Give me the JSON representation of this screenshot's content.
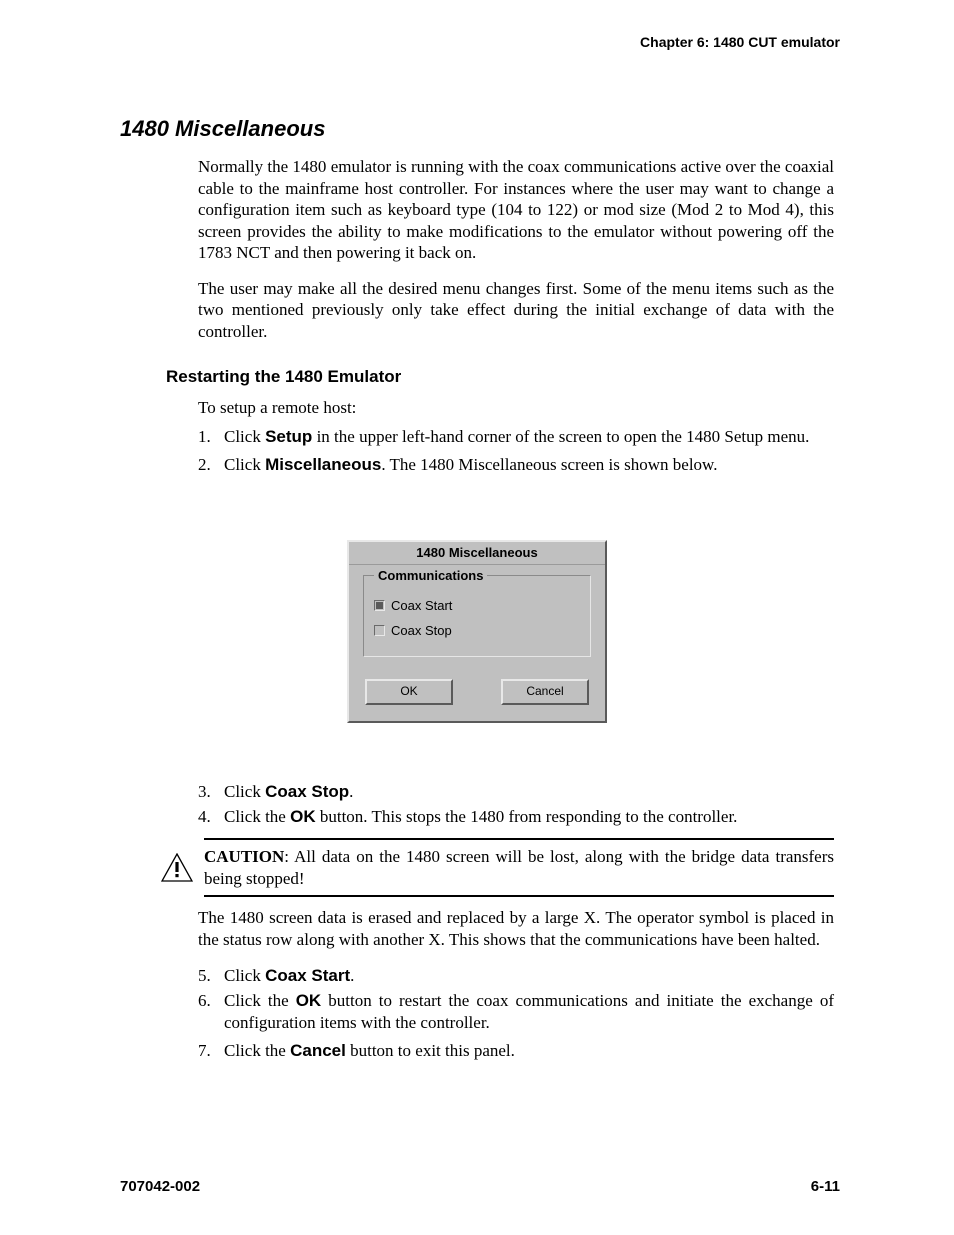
{
  "header": {
    "chapter": "Chapter 6: 1480 CUT emulator"
  },
  "section": {
    "title": "1480 Miscellaneous"
  },
  "paragraphs": {
    "p1": "Normally the 1480 emulator is running with the coax communications active over the coaxial cable to the mainframe host controller. For instances where the user may want to change a configuration item such as keyboard type (104 to 122) or mod size (Mod 2 to Mod 4), this screen provides the ability to make modifications to the emulator without powering off the 1783 NCT and then powering it back on.",
    "p2": "The user may make all the desired menu changes first. Some of the menu items such as the two mentioned previously only take effect during the initial exchange of data with the controller.",
    "intro": "To setup a remote host:",
    "afterCaution": "The 1480 screen data is erased and replaced by a large X. The operator symbol is placed in the status row along with another X. This shows that the communications have been halted."
  },
  "subheading": "Restarting the 1480 Emulator",
  "steps": {
    "s1a": "Click ",
    "s1b": "Setup",
    "s1c": " in the upper left-hand corner of the screen to open the 1480 Setup menu.",
    "s2a": "Click ",
    "s2b": "Miscellaneous",
    "s2c": ". The 1480 Miscellaneous screen is shown below.",
    "s3a": "Click ",
    "s3b": "Coax Stop",
    "s3c": ".",
    "s4a": "Click the ",
    "s4b": "OK",
    "s4c": " button. This stops the 1480 from responding to the controller.",
    "s5a": "Click ",
    "s5b": "Coax Start",
    "s5c": ".",
    "s6a": "Click the ",
    "s6b": "OK",
    "s6c": " button to restart the coax communications and initiate the exchange of configuration items with the controller.",
    "s7a": "Click the ",
    "s7b": "Cancel",
    "s7c": " button to exit this panel."
  },
  "dialog": {
    "title": "1480 Miscellaneous",
    "group": "Communications",
    "opt1": "Coax Start",
    "opt2": "Coax Stop",
    "ok": "OK",
    "cancel": "Cancel"
  },
  "caution": {
    "label": "CAUTION",
    "text": ": All data on the 1480 screen will be lost, along with the bridge data transfers being stopped!"
  },
  "footer": {
    "left": "707042-002",
    "right": "6-11"
  },
  "nums": {
    "n1": "1.",
    "n2": "2.",
    "n3": "3.",
    "n4": "4.",
    "n5": "5.",
    "n6": "6.",
    "n7": "7."
  }
}
